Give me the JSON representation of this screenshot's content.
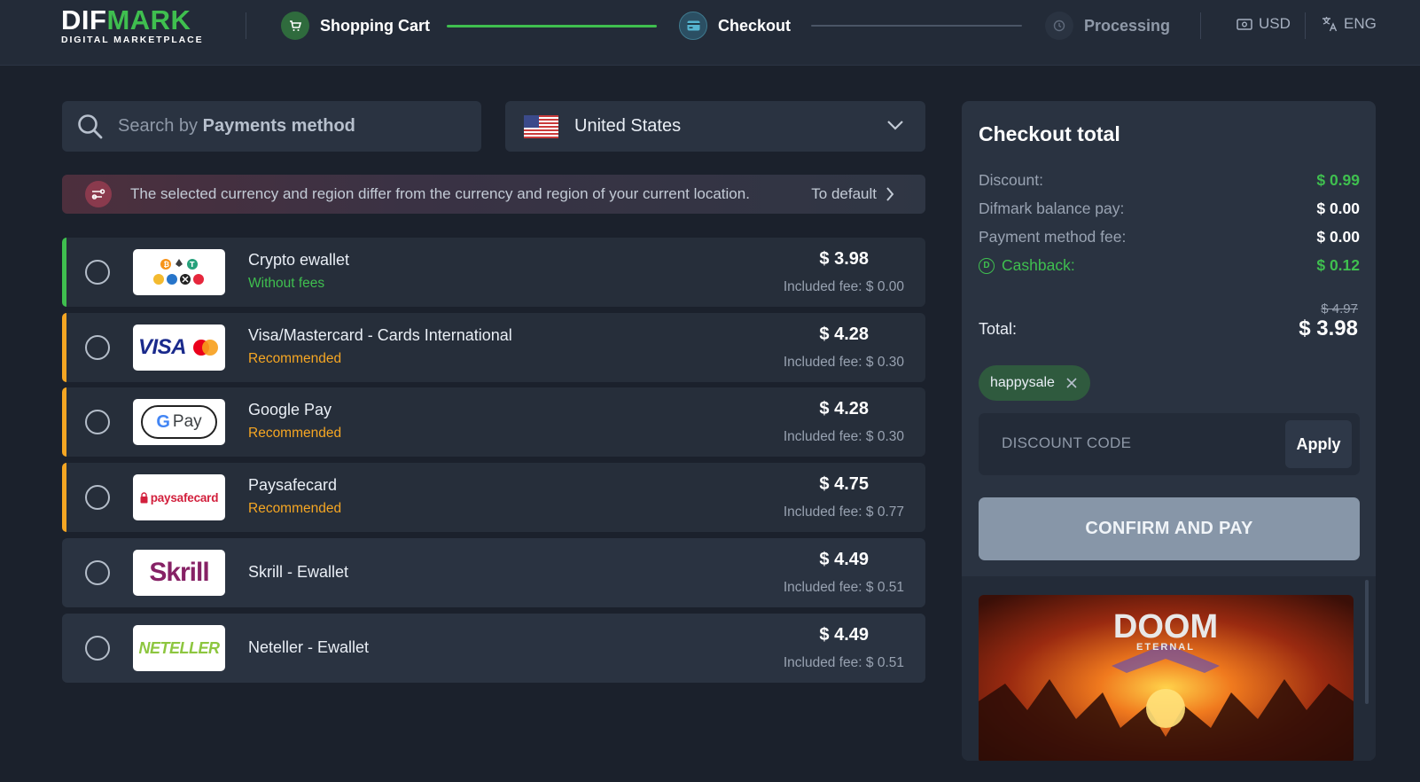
{
  "header": {
    "logo_main_white": "DIF",
    "logo_main_green": "MARK",
    "logo_sub": "DIGITAL MARKETPLACE",
    "steps": [
      {
        "label": "Shopping Cart",
        "state": "done"
      },
      {
        "label": "Checkout",
        "state": "active"
      },
      {
        "label": "Processing",
        "state": "pending"
      }
    ],
    "currency": "USD",
    "language": "ENG"
  },
  "search": {
    "placeholder_prefix": "Search by ",
    "placeholder_bold": "Payments method"
  },
  "country": {
    "selected": "United States"
  },
  "warning": {
    "text": "The selected currency and region differ from the currency and region of your current location.",
    "link": "To default"
  },
  "payment_methods": [
    {
      "name": "Crypto ewallet",
      "subtitle": "Without fees",
      "subtitle_color": "#3fbf4f",
      "accent": "#3fbf4f",
      "price": "$ 3.98",
      "fee": "Included fee: $ 0.00",
      "logo": "crypto-logo"
    },
    {
      "name": "Visa/Mastercard - Cards International",
      "subtitle": "Recommended",
      "subtitle_color": "#f5a623",
      "accent": "#f5a623",
      "price": "$ 4.28",
      "fee": "Included fee: $ 0.30",
      "logo": "visa-mastercard-logo"
    },
    {
      "name": "Google Pay",
      "subtitle": "Recommended",
      "subtitle_color": "#f5a623",
      "accent": "#f5a623",
      "price": "$ 4.28",
      "fee": "Included fee: $ 0.30",
      "logo": "google-pay-logo"
    },
    {
      "name": "Paysafecard",
      "subtitle": "Recommended",
      "subtitle_color": "#f5a623",
      "accent": "#f5a623",
      "price": "$ 4.75",
      "fee": "Included fee: $ 0.77",
      "logo": "paysafecard-logo"
    },
    {
      "name": "Skrill - Ewallet",
      "subtitle": "",
      "price": "$ 4.49",
      "fee": "Included fee: $ 0.51",
      "logo": "skrill-logo"
    },
    {
      "name": "Neteller - Ewallet",
      "subtitle": "",
      "price": "$ 4.49",
      "fee": "Included fee: $ 0.51",
      "logo": "neteller-logo"
    }
  ],
  "logos": {
    "visa": "VISA",
    "gpay": "Pay",
    "paysafe": "paysafecard",
    "skrill": "Skrill",
    "neteller": "NETELLER"
  },
  "checkout": {
    "title": "Checkout total",
    "rows": [
      {
        "label": "Discount:",
        "value": "$ 0.99",
        "color": "#3fbf4f"
      },
      {
        "label": "Difmark balance pay:",
        "value": "$ 0.00",
        "color": "#ffffff"
      },
      {
        "label": "Payment method fee:",
        "value": "$ 0.00",
        "color": "#ffffff"
      },
      {
        "label": "Cashback:",
        "value": "$ 0.12",
        "color": "#3fbf4f"
      }
    ],
    "old_total": "$ 4.97",
    "total_label": "Total:",
    "total_value": "$ 3.98",
    "promo_code": "happysale",
    "discount_placeholder": "DISCOUNT CODE",
    "apply_label": "Apply",
    "confirm_label": "CONFIRM AND PAY",
    "game_title": "DOOM",
    "game_subtitle": "ETERNAL"
  },
  "colors": {
    "brand_green": "#3fbf4f",
    "recommended_orange": "#f5a623",
    "background": "#1b212c",
    "panel": "#2a3341"
  }
}
